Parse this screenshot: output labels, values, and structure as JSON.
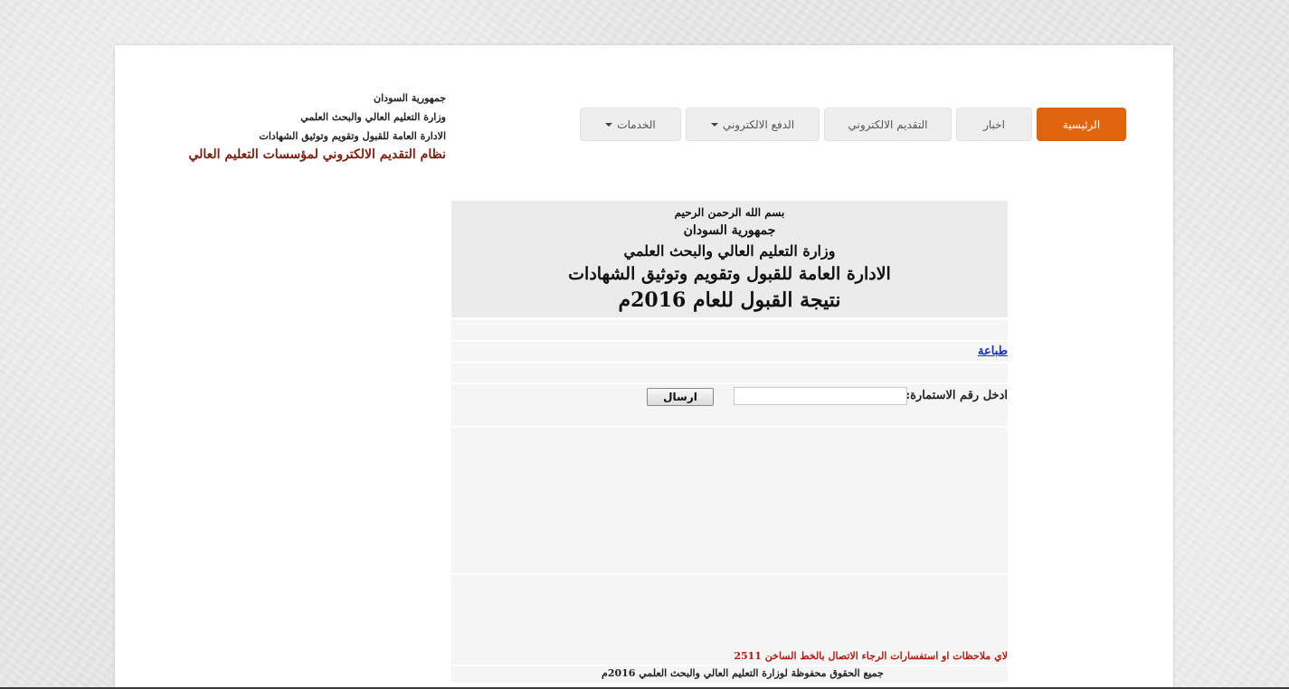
{
  "header": {
    "line1": "جمهورية السودان",
    "line2": "وزارة التعليم العالي والبحث العلمي",
    "line3": "الادارة العامة للقبول وتقويم وتوثيق الشهادات",
    "system_title": "نظام التقديم الالكتروني لمؤسسات التعليم العالي"
  },
  "nav": {
    "items": [
      {
        "label": "الرئيسية",
        "active": true
      },
      {
        "label": "اخبار"
      },
      {
        "label": "التقديم الالكتروني"
      },
      {
        "label": "الدفع الالكتروني",
        "dropdown": true
      },
      {
        "label": "الخدمات",
        "dropdown": true
      }
    ],
    "accent_color": "#e0650d"
  },
  "banner": {
    "basmala": "بسم الله الرحمن الرحيم",
    "country": "جمهورية السودان",
    "ministry": "وزارة التعليم العالي والبحث العلمي",
    "department": "الادارة العامة للقبول وتقويم وتوثيق الشهادات",
    "result_title": "نتيجة القبول للعام 2016م"
  },
  "print_link": "طباعة",
  "form": {
    "label": "ادخل رقم الاستمارة:",
    "input_value": "",
    "submit_label": "ارسال"
  },
  "footer": {
    "contact": "لاي ملاحظات او استفسارات الرجاء الاتصال بالخط الساخن 2511",
    "copyright": "جميع الحقوق محفوظة لوزارة التعليم العالي والبحث العلمي 2016م"
  }
}
